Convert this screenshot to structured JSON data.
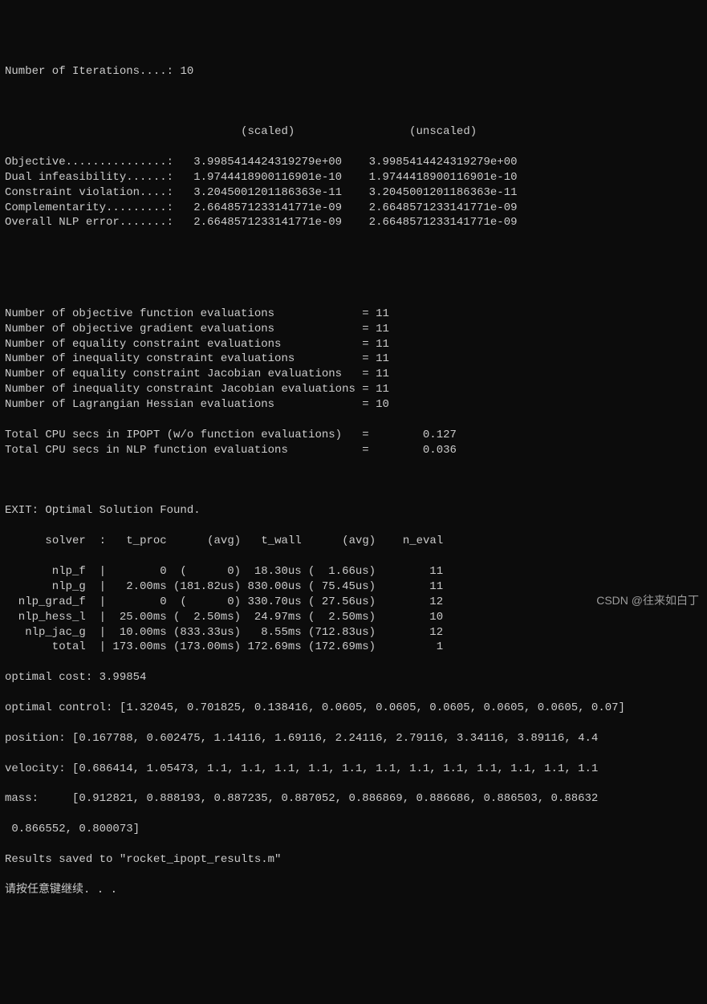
{
  "iterations": {
    "label": "Number of Iterations....:",
    "value": "10"
  },
  "headers": {
    "scaled": "(scaled)",
    "unscaled": "(unscaled)"
  },
  "metrics": [
    {
      "label": "Objective...............:",
      "scaled": "3.9985414424319279e+00",
      "unscaled": "3.9985414424319279e+00"
    },
    {
      "label": "Dual infeasibility......:",
      "scaled": "1.9744418900116901e-10",
      "unscaled": "1.9744418900116901e-10"
    },
    {
      "label": "Constraint violation....:",
      "scaled": "3.2045001201186363e-11",
      "unscaled": "3.2045001201186363e-11"
    },
    {
      "label": "Complementarity.........:",
      "scaled": "2.6648571233141771e-09",
      "unscaled": "2.6648571233141771e-09"
    },
    {
      "label": "Overall NLP error.......:",
      "scaled": "2.6648571233141771e-09",
      "unscaled": "2.6648571233141771e-09"
    }
  ],
  "counts": [
    {
      "label": "Number of objective function evaluations",
      "value": "11"
    },
    {
      "label": "Number of objective gradient evaluations",
      "value": "11"
    },
    {
      "label": "Number of equality constraint evaluations",
      "value": "11"
    },
    {
      "label": "Number of inequality constraint evaluations",
      "value": "11"
    },
    {
      "label": "Number of equality constraint Jacobian evaluations",
      "value": "11"
    },
    {
      "label": "Number of inequality constraint Jacobian evaluations",
      "value": "11"
    },
    {
      "label": "Number of Lagrangian Hessian evaluations",
      "value": "10"
    }
  ],
  "cpu": [
    {
      "label": "Total CPU secs in IPOPT (w/o function evaluations)",
      "value": "0.127"
    },
    {
      "label": "Total CPU secs in NLP function evaluations",
      "value": "0.036"
    }
  ],
  "exit": "EXIT: Optimal Solution Found.",
  "solver_header": {
    "c0": "solver",
    "c1": "t_proc",
    "c2": "(avg)",
    "c3": "t_wall",
    "c4": "(avg)",
    "c5": "n_eval"
  },
  "solver_rows": [
    {
      "name": "nlp_f",
      "t_proc": "0",
      "avg1": "(      0)",
      "t_wall": "18.30us",
      "avg2": "(  1.66us)",
      "n": "11"
    },
    {
      "name": "nlp_g",
      "t_proc": "2.00ms",
      "avg1": "(181.82us)",
      "t_wall": "830.00us",
      "avg2": "( 75.45us)",
      "n": "11"
    },
    {
      "name": "nlp_grad_f",
      "t_proc": "0",
      "avg1": "(      0)",
      "t_wall": "330.70us",
      "avg2": "( 27.56us)",
      "n": "12"
    },
    {
      "name": "nlp_hess_l",
      "t_proc": "25.00ms",
      "avg1": "(  2.50ms)",
      "t_wall": "24.97ms",
      "avg2": "(  2.50ms)",
      "n": "10"
    },
    {
      "name": "nlp_jac_g",
      "t_proc": "10.00ms",
      "avg1": "(833.33us)",
      "t_wall": "8.55ms",
      "avg2": "(712.83us)",
      "n": "12"
    },
    {
      "name": "total",
      "t_proc": "173.00ms",
      "avg1": "(173.00ms)",
      "t_wall": "172.69ms",
      "avg2": "(172.69ms)",
      "n": "1"
    }
  ],
  "optimal_cost": {
    "label": "optimal cost:",
    "value": "3.99854"
  },
  "optimal_control": {
    "label": "optimal control:",
    "text": "[1.32045, 0.701825, 0.138416, 0.0605, 0.0605, 0.0605, 0.0605, 0.0605, 0.07]"
  },
  "position": {
    "label": "position:",
    "text": "[0.167788, 0.602475, 1.14116, 1.69116, 2.24116, 2.79116, 3.34116, 3.89116, 4.4"
  },
  "velocity": {
    "label": "velocity:",
    "text": "[0.686414, 1.05473, 1.1, 1.1, 1.1, 1.1, 1.1, 1.1, 1.1, 1.1, 1.1, 1.1, 1.1, 1.1"
  },
  "mass": {
    "label": "mass:",
    "text": "[0.912821, 0.888193, 0.887235, 0.887052, 0.886869, 0.886686, 0.886503, 0.88632",
    "text2": " 0.866552, 0.800073]"
  },
  "results_saved": "Results saved to \"rocket_ipopt_results.m\"",
  "press_key": "请按任意键继续. . .",
  "watermark": "CSDN @往来如白丁"
}
